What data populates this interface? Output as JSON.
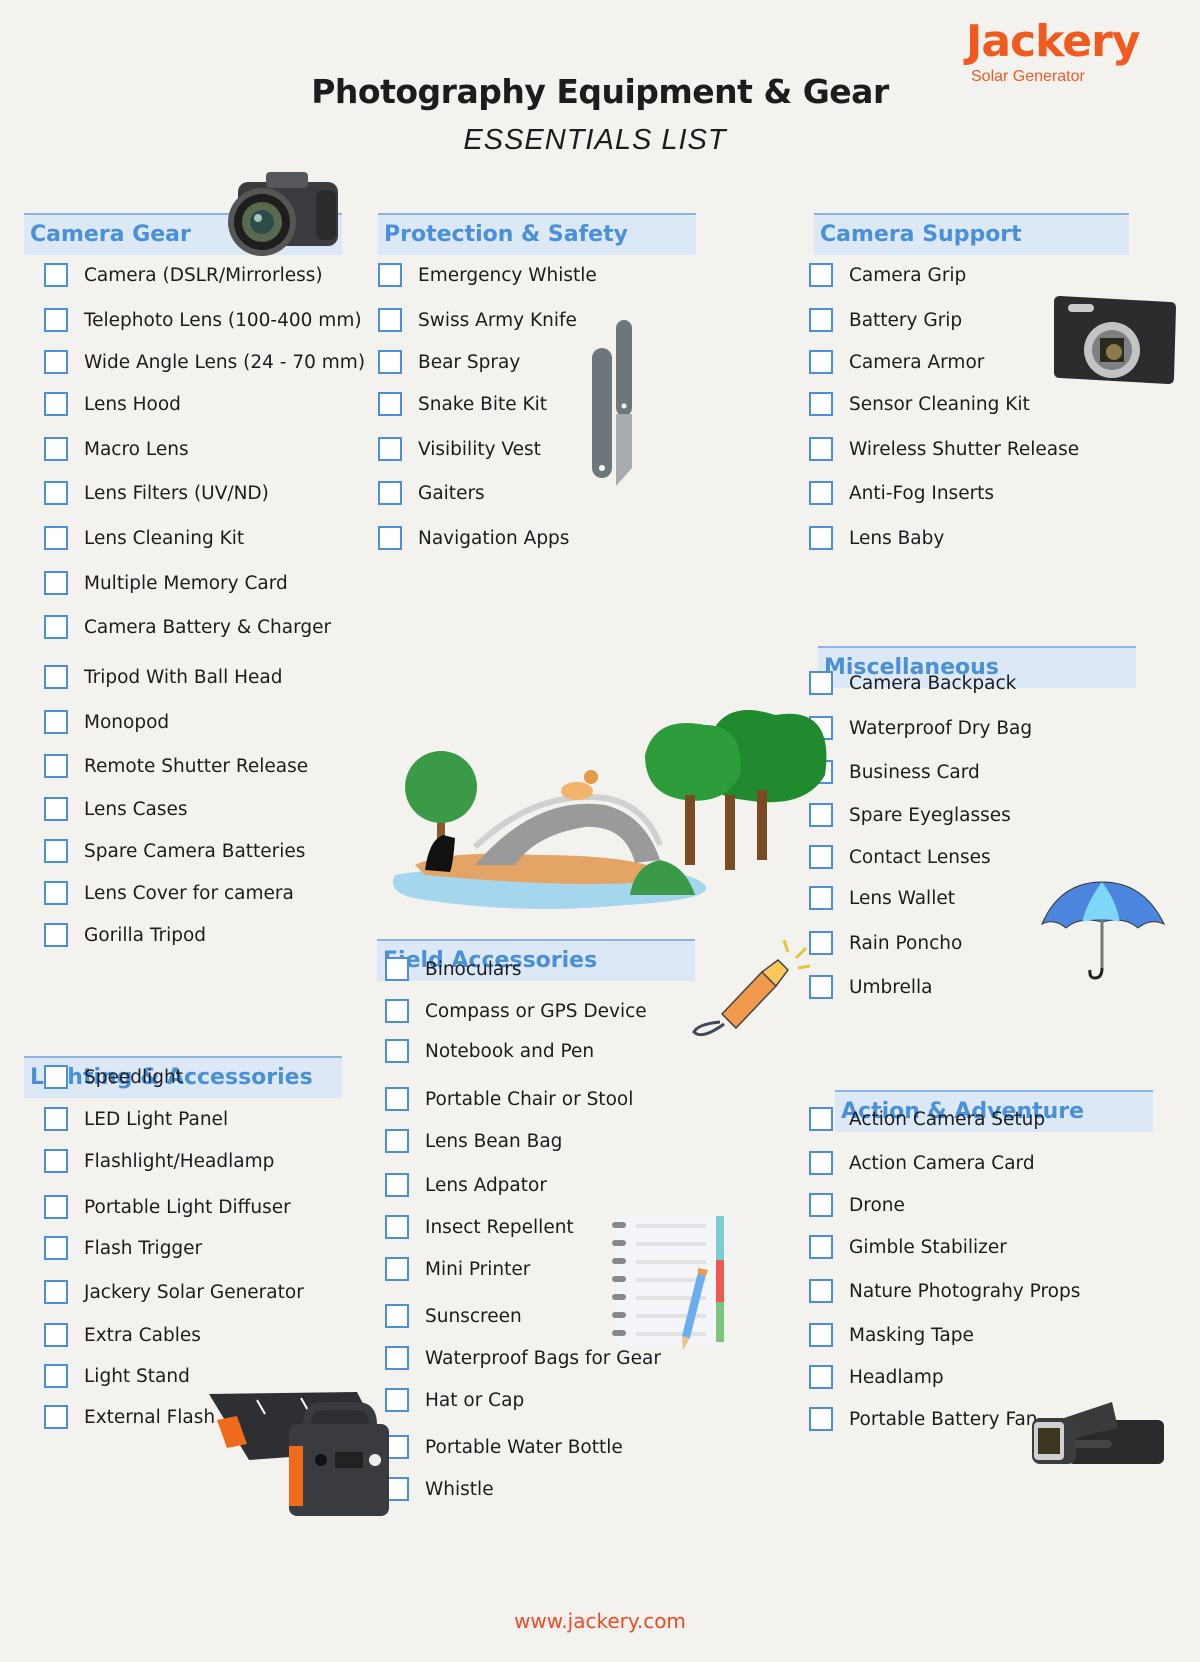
{
  "brand": {
    "name": "Jackery",
    "tagline": "Solar Generator",
    "color": "#f05a1f"
  },
  "header": {
    "title": "Photography Equipment & Gear",
    "subtitle": "ESSENTIALS LIST"
  },
  "colors": {
    "section_header_bg": "#dce8f5",
    "section_header_text": "#4a90d9",
    "checkbox_border": "#4a90d9",
    "page_bg": "#f3f2ee"
  },
  "sections": {
    "camera_gear": {
      "title": "Camera Gear",
      "items": [
        "Camera (DSLR/Mirrorless)",
        "Telephoto Lens (100-400 mm)",
        "Wide Angle Lens (24 - 70 mm)",
        "Lens Hood",
        "Macro Lens",
        "Lens Filters (UV/ND)",
        "Lens Cleaning Kit",
        "Multiple Memory Card",
        "Camera Battery & Charger",
        "Tripod With Ball Head",
        "Monopod",
        "Remote Shutter Release",
        "Lens Cases",
        "Spare Camera Batteries",
        "Lens Cover for camera",
        "Gorilla Tripod"
      ]
    },
    "protection_safety": {
      "title": "Protection & Safety",
      "items": [
        "Emergency Whistle",
        "Swiss Army Knife",
        "Bear Spray",
        "Snake Bite Kit",
        "Visibility Vest",
        "Gaiters",
        "Navigation Apps"
      ]
    },
    "camera_support": {
      "title": "Camera Support",
      "items": [
        "Camera Grip",
        "Battery Grip",
        "Camera Armor",
        "Sensor Cleaning Kit",
        "Wireless Shutter Release",
        "Anti-Fog Inserts",
        "Lens Baby"
      ]
    },
    "miscellaneous": {
      "title": "Miscellaneous",
      "items": [
        "Camera Backpack",
        "Waterproof Dry Bag",
        "Business Card",
        "Spare Eyeglasses",
        "Contact Lenses",
        "Lens Wallet",
        "Rain Poncho",
        "Umbrella"
      ]
    },
    "field_accessories": {
      "title": "Field Accessories",
      "items": [
        "Binoculars",
        "Compass or GPS Device",
        "Notebook and Pen",
        "Portable Chair or Stool",
        "Lens Bean Bag",
        "Lens Adpator",
        "Insect Repellent",
        "Mini Printer",
        "Sunscreen",
        "Waterproof Bags for Gear",
        "Hat or Cap",
        "Portable Water Bottle",
        "Whistle"
      ]
    },
    "lighting_accessories": {
      "title": "Lighting & Accessories",
      "items": [
        "Speedlight",
        "LED Light Panel",
        "Flashlight/Headlamp",
        "Portable Light Diffuser",
        "Flash Trigger",
        "Jackery Solar Generator",
        "Extra Cables",
        "Light Stand",
        "External Flash"
      ]
    },
    "action_adventure": {
      "title": "Action & Adventure",
      "items": [
        "Action Camera Setup",
        "Action Camera Card",
        "Drone",
        "Gimble Stabilizer",
        "Nature Photograhy Props",
        "Masking Tape",
        "Headlamp",
        "Portable Battery Fan"
      ]
    }
  },
  "illustrations": {
    "dslr": "dslr-camera-icon",
    "knife": "pocket-knife-icon",
    "compact": "compact-camera-icon",
    "landscape": "park-landscape-illustration",
    "umbrella": "umbrella-icon",
    "flashlight": "flashlight-icon",
    "notebook": "notebook-pencil-icon",
    "generator": "solar-generator-icon",
    "camcorder": "camcorder-icon"
  },
  "footer": {
    "url": "www.jackery.com"
  }
}
